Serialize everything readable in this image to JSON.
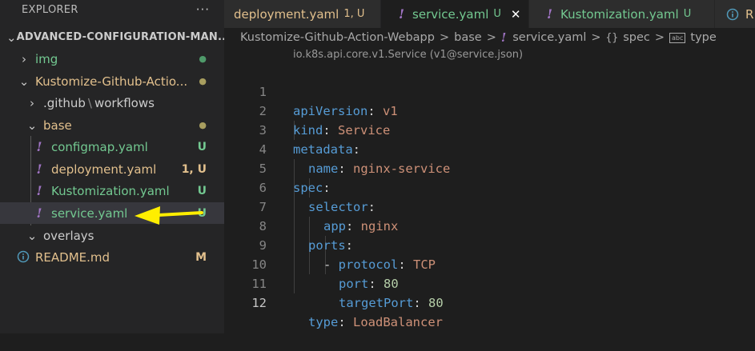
{
  "explorer": {
    "title": "EXPLORER",
    "more_label": "···",
    "root_folder": "ADVANCED-CONFIGURATION-MAN...",
    "tree": [
      {
        "label": "img",
        "decoration": "●"
      },
      {
        "label": "Kustomize-Github-Actio...",
        "decoration": "●"
      },
      {
        "label": ".github",
        "label2": "workflows",
        "decoration": ""
      },
      {
        "label": "base",
        "decoration": "●"
      },
      {
        "label": "configmap.yaml",
        "decoration": "U"
      },
      {
        "label": "deployment.yaml",
        "decoration": "1, U"
      },
      {
        "label": "Kustomization.yaml",
        "decoration": "U"
      },
      {
        "label": "service.yaml",
        "decoration": "U"
      },
      {
        "label": "overlays",
        "decoration": ""
      },
      {
        "label": "README.md",
        "decoration": "M"
      }
    ]
  },
  "tabs": [
    {
      "label": "deployment.yaml",
      "badge": "1, U",
      "icon": "yaml-icon"
    },
    {
      "label": "service.yaml",
      "badge": "U",
      "icon": "yaml-icon",
      "active": true,
      "close": "✕"
    },
    {
      "label": "Kustomization.yaml",
      "badge": "U",
      "icon": "yaml-icon"
    },
    {
      "label": "R",
      "icon": "info-icon"
    }
  ],
  "breadcrumb": {
    "items": [
      "Kustomize-Github-Action-Webapp",
      "base",
      "service.yaml",
      "spec",
      "type"
    ],
    "separator": ">",
    "sym_object": "{}",
    "sym_type": "abc"
  },
  "editor": {
    "schema_hint": "io.k8s.api.core.v1.Service (v1@service.json)",
    "current_line": 12,
    "lines": [
      {
        "n": "1",
        "k": "apiVersion",
        "p": ": ",
        "v": "v1"
      },
      {
        "n": "2",
        "k": "kind",
        "p": ": ",
        "v": "Service"
      },
      {
        "n": "3",
        "k": "metadata",
        "p": ":",
        "v": ""
      },
      {
        "n": "4",
        "k": "name",
        "p": ": ",
        "v": "nginx-service"
      },
      {
        "n": "5",
        "k": "spec",
        "p": ":",
        "v": ""
      },
      {
        "n": "6",
        "k": "selector",
        "p": ":",
        "v": ""
      },
      {
        "n": "7",
        "k": "app",
        "p": ": ",
        "v": "nginx"
      },
      {
        "n": "8",
        "k": "ports",
        "p": ":",
        "v": ""
      },
      {
        "n": "9",
        "dash": "- ",
        "k": "protocol",
        "p": ": ",
        "v": "TCP"
      },
      {
        "n": "10",
        "k": "port",
        "p": ": ",
        "num": "80"
      },
      {
        "n": "11",
        "k": "targetPort",
        "p": ": ",
        "num": "80"
      },
      {
        "n": "12",
        "k": "type",
        "p": ": ",
        "v": "LoadBalancer"
      }
    ]
  },
  "colors": {
    "untracked": "#73c991",
    "modified": "#e2c08d",
    "yaml_icon": "#a074c4",
    "arrow": "#ffee00"
  }
}
